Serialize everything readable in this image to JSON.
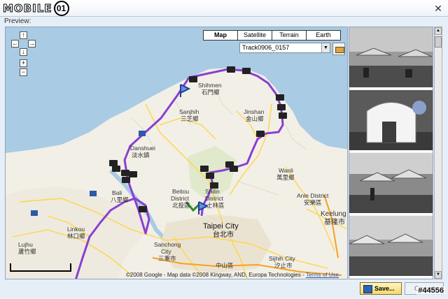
{
  "app": {
    "logo_text": "MOBILE",
    "logo_badge": "01",
    "close_glyph": "✕"
  },
  "preview_label": "Preview:",
  "map": {
    "type_buttons": [
      {
        "label": "Map",
        "active": true
      },
      {
        "label": "Satellite",
        "active": false
      },
      {
        "label": "Terrain",
        "active": false
      },
      {
        "label": "Earth",
        "active": false
      }
    ],
    "track_select": {
      "value": "Track0906_0157"
    },
    "pan": {
      "up": "↑",
      "left": "←",
      "right": "→",
      "down": "↓",
      "zoom_in": "+",
      "zoom_out": "−"
    },
    "labels": {
      "shihmen": "Shihmen",
      "shihmen_zh": "石門鄉",
      "sanjhih": "Sanjhih",
      "sanjhih_zh": "三芝鄉",
      "jinshan": "Jinshan",
      "jinshan_zh": "金山鄉",
      "danshuei": "Danshuei",
      "danshuei_zh": "淡水鎮",
      "wanli": "Wanli",
      "wanli_zh": "萬里鄉",
      "bali": "Bali",
      "bali_zh": "八里鄉",
      "beitou": "Beitou",
      "beitou2": "District",
      "beitou_zh": "北投區",
      "shilin": "Shilin",
      "shilin2": "District",
      "shilin_zh": "士林區",
      "anle": "Anle District",
      "anle_zh": "安樂區",
      "keelung": "Keelung",
      "keelung_zh": "基隆市",
      "taipei": "Taipei City",
      "taipei_zh": "台北市",
      "linkou": "Linkou",
      "linkou_zh": "林口鄉",
      "sanchong": "Sanchong",
      "sanchong2": "City",
      "sanchong_zh": "三重市",
      "lujhu": "Lujhu",
      "lujhu_zh": "蘆竹鄉",
      "sijhih": "Sijhih City",
      "sijhih_zh": "汐止市",
      "jhongshan": "中山區"
    },
    "copyright": "©2008 Google - Map data ©2008 Kingway, AND, Europa Technologies -",
    "terms": "Terms of Use",
    "route_color": "#8a3fd1",
    "water_color": "#a9cbe4",
    "land_color": "#f2efe6"
  },
  "photos": [
    "beach-cafe-umbrellas",
    "white-dome-building",
    "cafe-umbrellas-terrace",
    "umbrella-tables"
  ],
  "buttons": {
    "save": "Save...",
    "cancel": "Cancel"
  },
  "watermark": "#44556"
}
